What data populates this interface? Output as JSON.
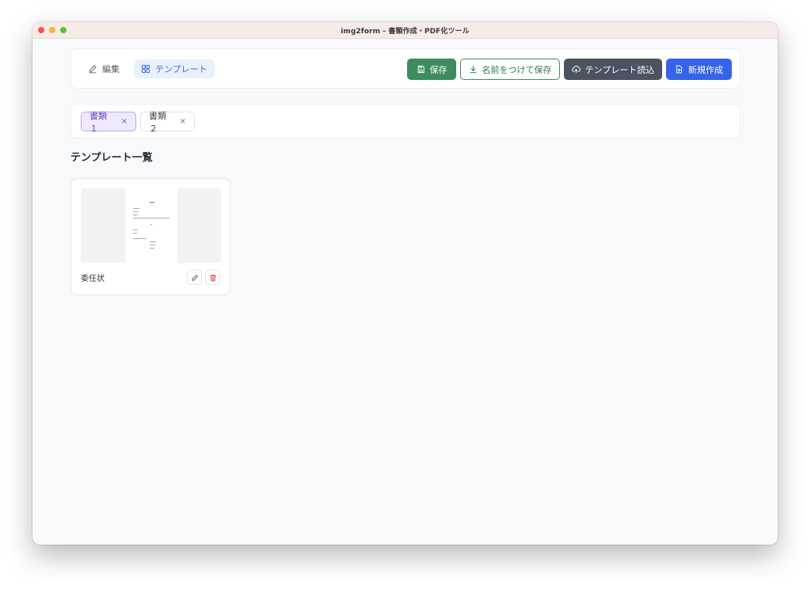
{
  "window": {
    "title": "img2form - 書類作成・PDF化ツール"
  },
  "toolbar": {
    "modes": [
      {
        "label": "編集",
        "icon": "pencil-icon",
        "active": false
      },
      {
        "label": "テンプレート",
        "icon": "grid-icon",
        "active": true
      }
    ],
    "actions": {
      "save_label": "保存",
      "save_as_label": "名前をつけて保存",
      "load_template_label": "テンプレート読込",
      "new_label": "新規作成"
    }
  },
  "documents": {
    "tabs": [
      {
        "label": "書類１",
        "close": "×",
        "active": true
      },
      {
        "label": "書類２",
        "close": "×",
        "active": false
      }
    ]
  },
  "templates": {
    "section_title": "テンプレート一覧",
    "items": [
      {
        "name": "委任状",
        "thumbnail_icon": "document-thumbnail"
      }
    ]
  },
  "colors": {
    "save": "#3d8c5f",
    "load": "#4b5260",
    "new": "#3563e9",
    "active_mode": "#3b69d6",
    "active_tab": "#5f43c6",
    "delete": "#e04545"
  }
}
